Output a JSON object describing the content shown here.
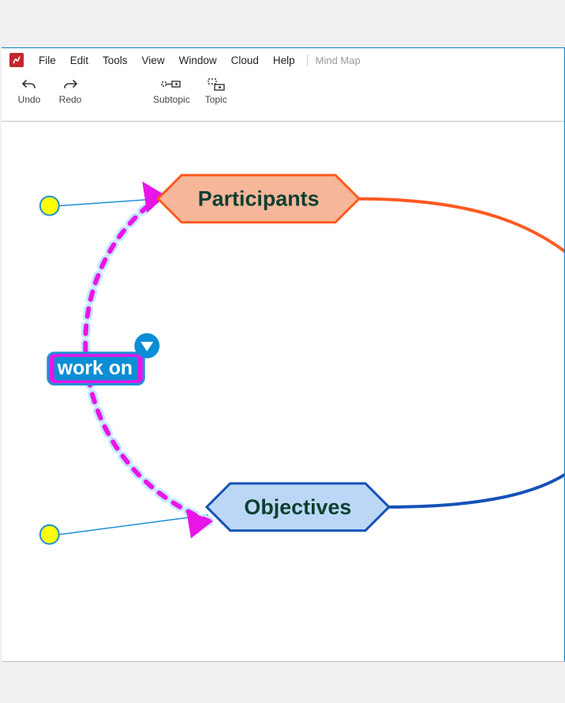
{
  "app": {
    "icon_name": "xmind-icon",
    "doc_title": "Mind Map"
  },
  "menu": {
    "items": [
      "File",
      "Edit",
      "Tools",
      "View",
      "Window",
      "Cloud",
      "Help"
    ]
  },
  "toolbar": {
    "undo": {
      "label": "Undo",
      "icon": "undo-icon"
    },
    "redo": {
      "label": "Redo",
      "icon": "redo-icon"
    },
    "subtopic": {
      "label": "Subtopic",
      "icon": "subtopic-icon"
    },
    "topic": {
      "label": "Topic",
      "icon": "topic-icon"
    }
  },
  "mindmap": {
    "nodes": {
      "participants": {
        "label": "Participants",
        "fill": "#f6b69a",
        "stroke": "#ff5a1f"
      },
      "objectives": {
        "label": "Objectives",
        "fill": "#bcd7f6",
        "stroke": "#1552b8"
      }
    },
    "relationship": {
      "label": "work on",
      "from": "participants",
      "to": "objectives",
      "color": "#e815e8"
    }
  }
}
